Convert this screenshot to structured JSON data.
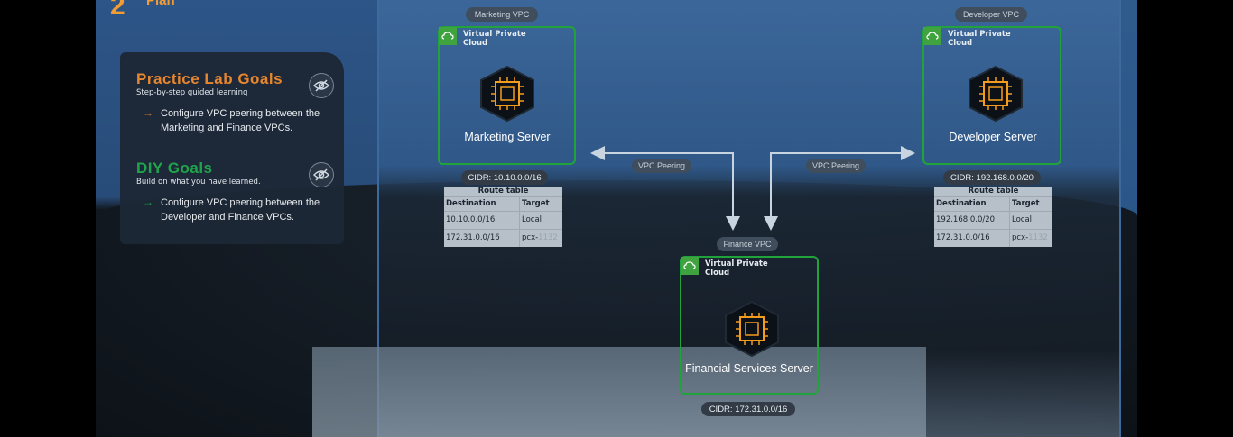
{
  "plan": {
    "text": "Plan"
  },
  "goals": {
    "practice_title": "Practice Lab Goals",
    "practice_sub": "Step-by-step guided learning",
    "practice_item": "Configure VPC peering between the Marketing and Finance VPCs.",
    "diy_title": "DIY Goals",
    "diy_sub": "Build on what you have learned.",
    "diy_item": "Configure VPC peering between the Developer and Finance VPCs.",
    "practice_color": "#f0892c",
    "diy_color": "#1fa84a"
  },
  "vpcs": {
    "marketing": {
      "tag": "Marketing VPC",
      "label": "Virtual Private Cloud",
      "server": "Marketing Server",
      "cidr": "CIDR: 10.10.0.0/16"
    },
    "developer": {
      "tag": "Developer VPC",
      "label": "Virtual Private Cloud",
      "server": "Developer Server",
      "cidr": "CIDR: 192.168.0.0/20"
    },
    "finance": {
      "tag": "Finance VPC",
      "label": "Virtual Private Cloud",
      "server": "Financial Services Server",
      "cidr": "CIDR: 172.31.0.0/16"
    }
  },
  "peering": {
    "left": "VPC Peering",
    "right": "VPC Peering"
  },
  "route_tables": {
    "marketing": {
      "title": "Route table",
      "headers": [
        "Destination",
        "Target"
      ],
      "rows": [
        [
          "10.10.0.0/16",
          "Local"
        ],
        [
          "172.31.0.0/16",
          "pcx-"
        ]
      ],
      "pcx_suffix": "1132"
    },
    "developer": {
      "title": "Route table",
      "headers": [
        "Destination",
        "Target"
      ],
      "rows": [
        [
          "192.168.0.0/20",
          "Local"
        ],
        [
          "172.31.0.0/16",
          "pcx-"
        ]
      ],
      "pcx_suffix": "1132"
    }
  },
  "icons": {
    "eye": "eye-slash-icon",
    "chip": "chip-icon",
    "cloud": "cloud-icon"
  }
}
